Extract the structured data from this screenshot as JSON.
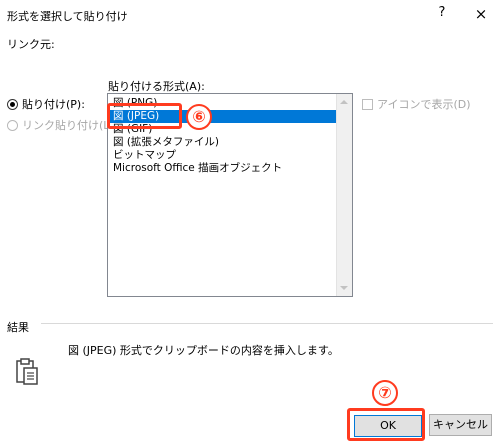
{
  "dialog": {
    "title": "形式を選択して貼り付け",
    "help_glyph": "?",
    "close_glyph": "×",
    "source_label": "リンク元:"
  },
  "options": {
    "paste_label": "貼り付け(P):",
    "paste_link_label": "リンク貼り付け(L):",
    "selected": "paste"
  },
  "format_list": {
    "label": "貼り付ける形式(A):",
    "items": [
      "図 (PNG)",
      "図 (JPEG)",
      "図 (GIF)",
      "図 (拡張メタファイル)",
      "ビットマップ",
      "Microsoft Office 描画オブジェクト"
    ],
    "selected_index": 1
  },
  "display_as_icon": {
    "label": "アイコンで表示(D)",
    "checked": false,
    "enabled": false
  },
  "result": {
    "label": "結果",
    "text": "図 (JPEG) 形式でクリップボードの内容を挿入します。"
  },
  "buttons": {
    "ok": "OK",
    "cancel": "キャンセル"
  },
  "annotations": {
    "step6": "⑥",
    "step7": "⑦",
    "highlight_color": "#ff3b1f"
  },
  "colors": {
    "selection": "#0078d7",
    "accent_border": "#0078d7"
  }
}
